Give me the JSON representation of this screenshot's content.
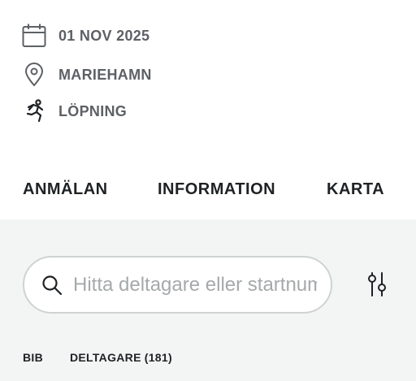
{
  "event": {
    "date": "01 NOV 2025",
    "location": "MARIEHAMN",
    "sport": "LÖPNING",
    "icons": {
      "date": "calendar-icon",
      "location": "map-pin-icon",
      "sport": "runner-icon"
    }
  },
  "tabs": [
    {
      "label": "ANMÄLAN"
    },
    {
      "label": "INFORMATION"
    },
    {
      "label": "KARTA"
    }
  ],
  "search": {
    "placeholder": "Hitta deltagare eller startnummer",
    "value": "",
    "icon": "search-icon"
  },
  "filter": {
    "icon": "sliders-icon"
  },
  "table": {
    "columns": {
      "bib": "BIB",
      "participants": "DELTAGARE",
      "count": "(181)"
    }
  },
  "colors": {
    "panel_bg": "#f3f5f4",
    "meta_text": "#5d6064",
    "text": "#1f2225",
    "border": "#cfd2d3"
  }
}
